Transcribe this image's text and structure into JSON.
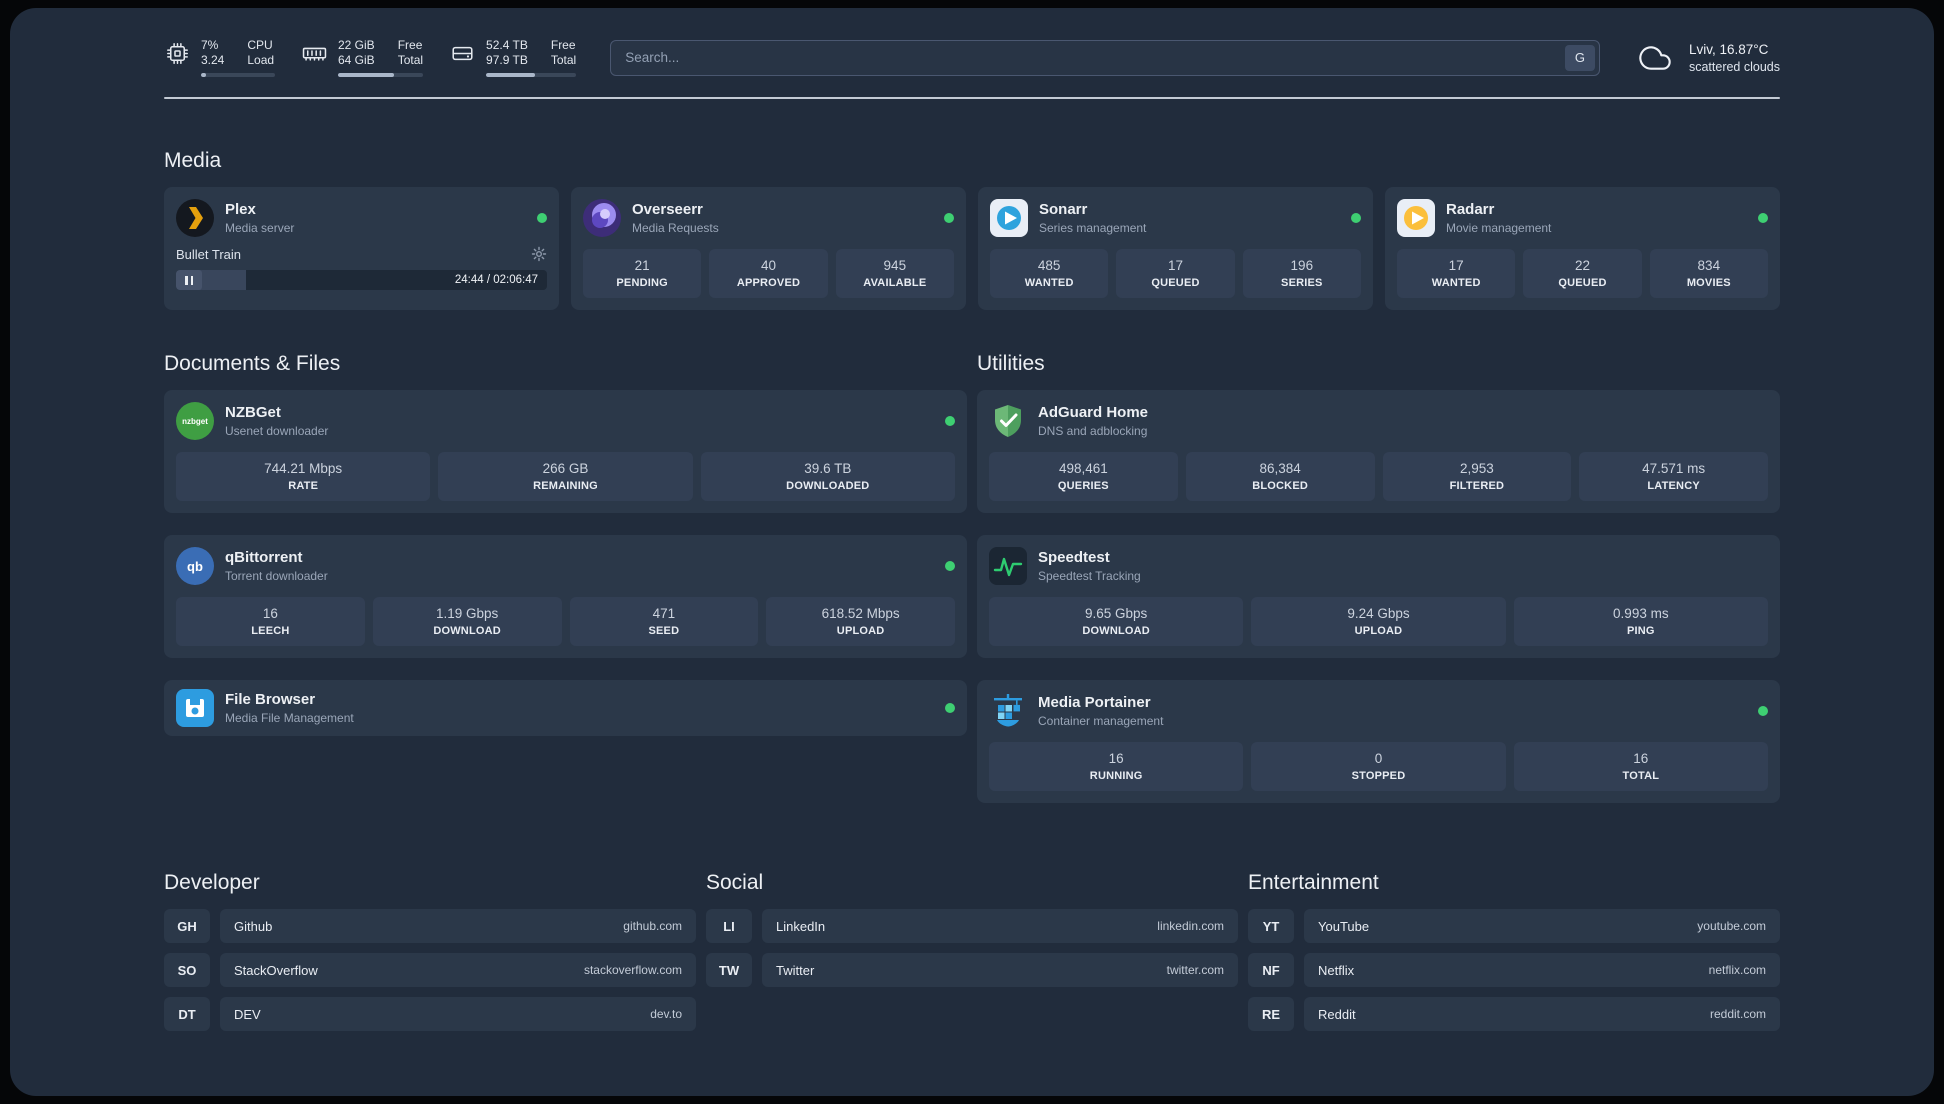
{
  "topbar": {
    "cpu": {
      "value_top": "7%",
      "value_bottom": "3.24",
      "label_top": "CPU",
      "label_bottom": "Load",
      "bar_percent": 7
    },
    "ram": {
      "value_top": "22 GiB",
      "value_bottom": "64 GiB",
      "label_top": "Free",
      "label_bottom": "Total",
      "bar_percent": 66
    },
    "disk": {
      "value_top": "52.4 TB",
      "value_bottom": "97.9 TB",
      "label_top": "Free",
      "label_bottom": "Total",
      "bar_percent": 54
    },
    "search": {
      "placeholder": "Search...",
      "button_label": "G"
    },
    "weather": {
      "location": "Lviv, 16.87°C",
      "condition": "scattered clouds"
    }
  },
  "sections": {
    "media": {
      "title": "Media",
      "plex": {
        "name": "Plex",
        "subtitle": "Media server",
        "now_playing": "Bullet Train",
        "time": "24:44 / 02:06:47",
        "progress_percent": 19
      },
      "overseerr": {
        "name": "Overseerr",
        "subtitle": "Media Requests",
        "stats": [
          {
            "value": "21",
            "label": "PENDING"
          },
          {
            "value": "40",
            "label": "APPROVED"
          },
          {
            "value": "945",
            "label": "AVAILABLE"
          }
        ]
      },
      "sonarr": {
        "name": "Sonarr",
        "subtitle": "Series management",
        "stats": [
          {
            "value": "485",
            "label": "WANTED"
          },
          {
            "value": "17",
            "label": "QUEUED"
          },
          {
            "value": "196",
            "label": "SERIES"
          }
        ]
      },
      "radarr": {
        "name": "Radarr",
        "subtitle": "Movie management",
        "stats": [
          {
            "value": "17",
            "label": "WANTED"
          },
          {
            "value": "22",
            "label": "QUEUED"
          },
          {
            "value": "834",
            "label": "MOVIES"
          }
        ]
      }
    },
    "documents": {
      "title": "Documents & Files",
      "nzbget": {
        "name": "NZBGet",
        "subtitle": "Usenet downloader",
        "stats": [
          {
            "value": "744.21 Mbps",
            "label": "RATE"
          },
          {
            "value": "266 GB",
            "label": "REMAINING"
          },
          {
            "value": "39.6 TB",
            "label": "DOWNLOADED"
          }
        ]
      },
      "qbittorrent": {
        "name": "qBittorrent",
        "subtitle": "Torrent downloader",
        "stats": [
          {
            "value": "16",
            "label": "LEECH"
          },
          {
            "value": "1.19 Gbps",
            "label": "DOWNLOAD"
          },
          {
            "value": "471",
            "label": "SEED"
          },
          {
            "value": "618.52 Mbps",
            "label": "UPLOAD"
          }
        ]
      },
      "filebrowser": {
        "name": "File Browser",
        "subtitle": "Media File Management"
      }
    },
    "utilities": {
      "title": "Utilities",
      "adguard": {
        "name": "AdGuard Home",
        "subtitle": "DNS and adblocking",
        "stats": [
          {
            "value": "498,461",
            "label": "QUERIES"
          },
          {
            "value": "86,384",
            "label": "BLOCKED"
          },
          {
            "value": "2,953",
            "label": "FILTERED"
          },
          {
            "value": "47.571 ms",
            "label": "LATENCY"
          }
        ]
      },
      "speedtest": {
        "name": "Speedtest",
        "subtitle": "Speedtest Tracking",
        "stats": [
          {
            "value": "9.65 Gbps",
            "label": "DOWNLOAD"
          },
          {
            "value": "9.24 Gbps",
            "label": "UPLOAD"
          },
          {
            "value": "0.993 ms",
            "label": "PING"
          }
        ]
      },
      "portainer": {
        "name": "Media Portainer",
        "subtitle": "Container management",
        "stats": [
          {
            "value": "16",
            "label": "RUNNING"
          },
          {
            "value": "0",
            "label": "STOPPED"
          },
          {
            "value": "16",
            "label": "TOTAL"
          }
        ]
      }
    },
    "bookmarks": {
      "developer": {
        "title": "Developer",
        "links": [
          {
            "abbr": "GH",
            "name": "Github",
            "url": "github.com"
          },
          {
            "abbr": "SO",
            "name": "StackOverflow",
            "url": "stackoverflow.com"
          },
          {
            "abbr": "DT",
            "name": "DEV",
            "url": "dev.to"
          }
        ]
      },
      "social": {
        "title": "Social",
        "links": [
          {
            "abbr": "LI",
            "name": "LinkedIn",
            "url": "linkedin.com"
          },
          {
            "abbr": "TW",
            "name": "Twitter",
            "url": "twitter.com"
          }
        ]
      },
      "entertainment": {
        "title": "Entertainment",
        "links": [
          {
            "abbr": "YT",
            "name": "YouTube",
            "url": "youtube.com"
          },
          {
            "abbr": "NF",
            "name": "Netflix",
            "url": "netflix.com"
          },
          {
            "abbr": "RE",
            "name": "Reddit",
            "url": "reddit.com"
          }
        ]
      }
    }
  },
  "colors": {
    "status_online": "#3ecf72",
    "plex_amber": "#e5a00d",
    "background": "#212c3c",
    "card": "#2b3849"
  }
}
